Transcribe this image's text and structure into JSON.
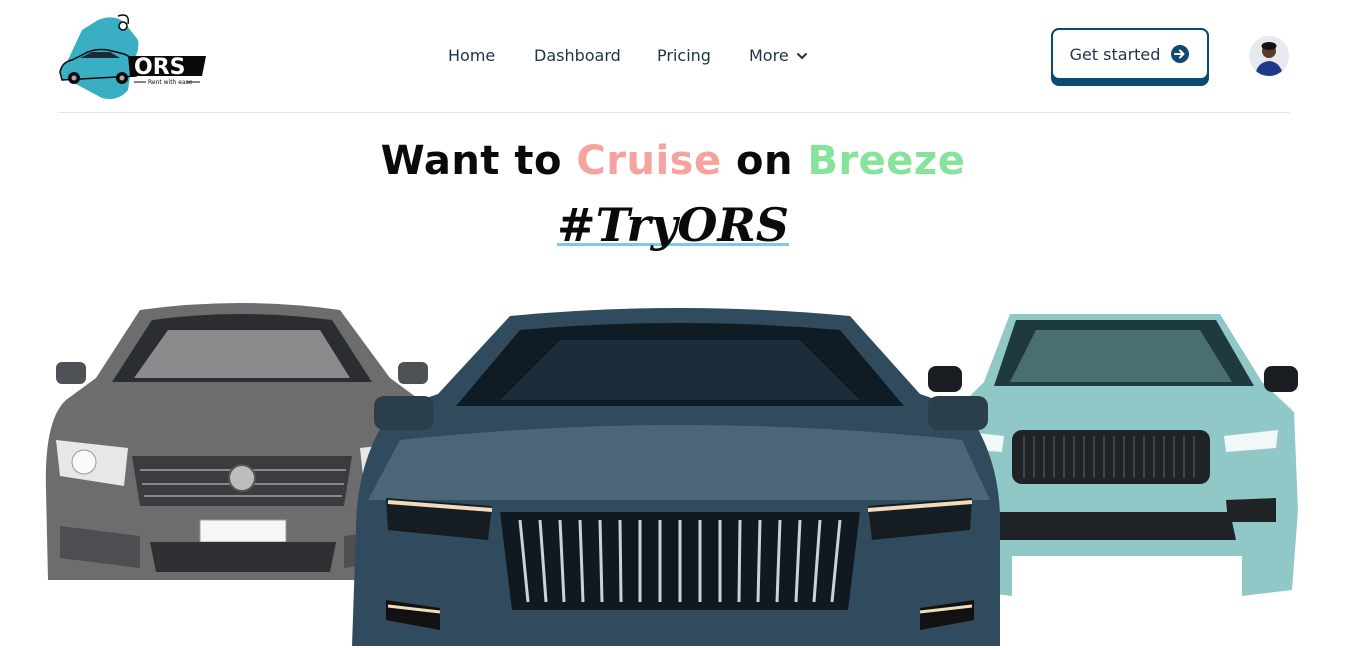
{
  "brand": {
    "logo_text": "ORS",
    "tagline": "Rent with ease",
    "colors": {
      "teal": "#3aaec2",
      "dark": "#0a0a0a"
    }
  },
  "nav": {
    "items": [
      {
        "label": "Home"
      },
      {
        "label": "Dashboard"
      },
      {
        "label": "Pricing"
      },
      {
        "label": "More"
      }
    ]
  },
  "cta": {
    "label": "Get started",
    "icon": "arrow-right-circle-icon",
    "accent": "#0c4a6e"
  },
  "user": {
    "avatar": "user-avatar"
  },
  "hero": {
    "title_part1": "Want to",
    "title_word1": "Cruise",
    "title_part2": "on",
    "title_word2": "Breeze",
    "hashtag": "#TryORS",
    "colors": {
      "cruise": "#f6a3a0",
      "breeze": "#86e39b",
      "underline": "#7cc9ee"
    }
  },
  "cars": [
    "gray-sedan",
    "dark-blue-suv",
    "mint-crossover"
  ]
}
